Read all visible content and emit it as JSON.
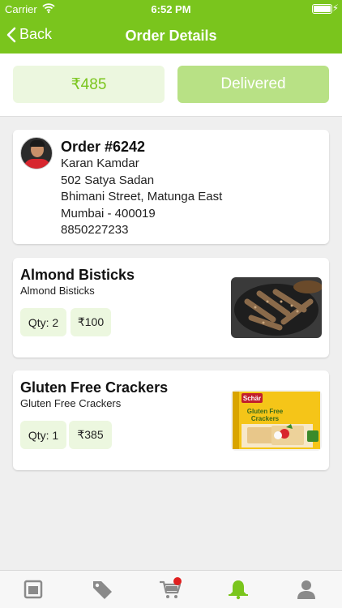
{
  "status_bar": {
    "carrier": "Carrier",
    "time": "6:52 PM"
  },
  "nav": {
    "back_label": "Back",
    "title": "Order Details"
  },
  "summary": {
    "total": "₹485",
    "status": "Delivered"
  },
  "order": {
    "number": "Order #6242",
    "customer_name": "Karan Kamdar",
    "address_line1": "502 Satya Sadan",
    "address_line2": "Bhimani Street, Matunga East",
    "address_line3": "Mumbai - 400019",
    "phone": "8850227233"
  },
  "items": [
    {
      "name": "Almond Bisticks",
      "description": "Almond Bisticks",
      "qty": "Qty: 2",
      "price": "₹100"
    },
    {
      "name": "Gluten Free Crackers",
      "description": "Gluten Free Crackers",
      "qty": "Qty: 1",
      "price": "₹385",
      "package_brand": "Schär",
      "package_title": "Gluten Free Crackers"
    }
  ],
  "tabs": [
    {
      "icon": "orders-icon",
      "active": false
    },
    {
      "icon": "tag-icon",
      "active": false
    },
    {
      "icon": "cart-icon",
      "active": false,
      "badge": true
    },
    {
      "icon": "bell-icon",
      "active": true
    },
    {
      "icon": "user-icon",
      "active": false
    }
  ],
  "colors": {
    "brand": "#7ac51d",
    "pill_bg": "#ecf7df",
    "status_bg": "#b8e185",
    "badge": "#e02020",
    "inactive_icon": "#8a8a8a"
  }
}
